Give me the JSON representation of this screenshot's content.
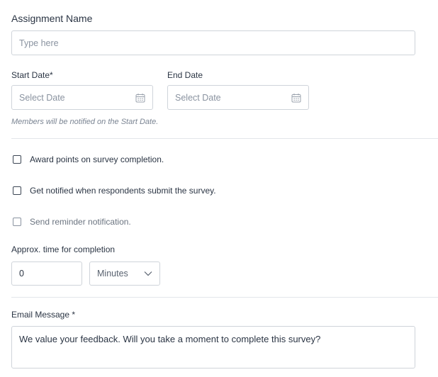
{
  "assignment": {
    "title": "Assignment Name",
    "placeholder": "Type here"
  },
  "dates": {
    "start_label": "Start Date*",
    "start_placeholder": "Select Date",
    "end_label": "End Date",
    "end_placeholder": "Select Date",
    "hint": "Members will be notified on the Start Date."
  },
  "options": [
    {
      "label": "Award points on survey completion.",
      "checked": false
    },
    {
      "label": "Get notified when respondents submit the survey.",
      "checked": false
    },
    {
      "label": "Send reminder notification.",
      "checked": false
    }
  ],
  "completion": {
    "label": "Approx. time for completion",
    "value": "0",
    "unit": "Minutes"
  },
  "email": {
    "label": "Email Message *",
    "message": "We value your feedback. Will you take a moment to complete this survey?"
  },
  "icons": {
    "calendar": "calendar-icon",
    "dropdown": "chevron-down-icon"
  },
  "colors": {
    "text": "#2b3544",
    "border": "#cfd4da",
    "muted": "#8a93a0",
    "divider": "#e3e6ea"
  }
}
